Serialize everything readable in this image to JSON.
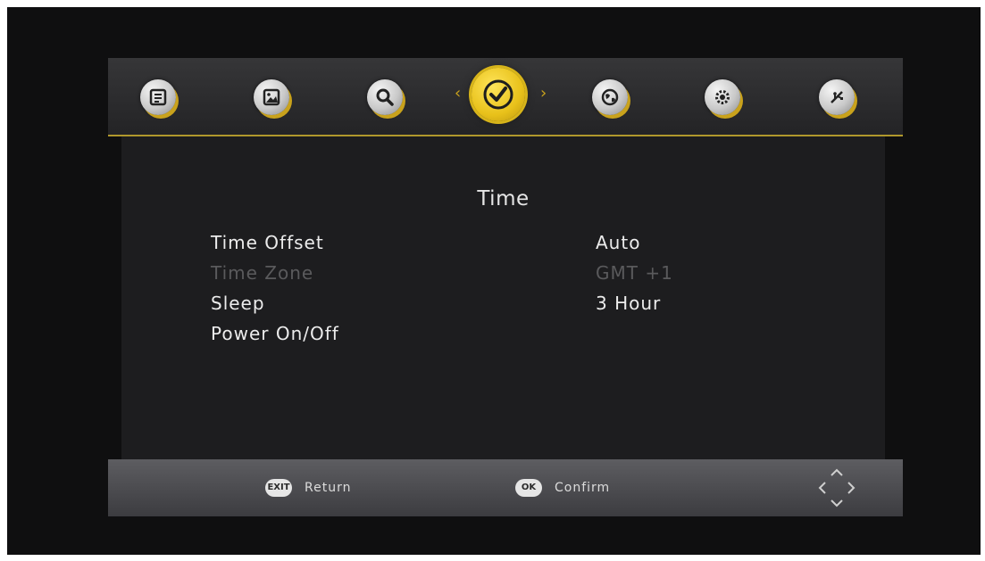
{
  "topbar": {
    "items": [
      {
        "icon": "channel-list-icon"
      },
      {
        "icon": "picture-icon"
      },
      {
        "icon": "search-icon"
      },
      {
        "icon": "clock-icon",
        "active": true
      },
      {
        "icon": "globe-icon"
      },
      {
        "icon": "gear-icon"
      },
      {
        "icon": "usb-icon"
      }
    ],
    "active_index": 3,
    "accent_color": "#e8c11a"
  },
  "menu": {
    "title": "Time",
    "items": [
      {
        "label": "Time Offset",
        "value": "Auto",
        "enabled": true
      },
      {
        "label": "Time Zone",
        "value": "GMT +1",
        "enabled": false
      },
      {
        "label": "Sleep",
        "value": "3 Hour",
        "enabled": true
      },
      {
        "label": "Power On/Off",
        "value": "",
        "enabled": true
      }
    ]
  },
  "footer": {
    "hints": [
      {
        "key": "EXIT",
        "label": "Return"
      },
      {
        "key": "OK",
        "label": "Confirm"
      }
    ],
    "nav_icon": "direction-pad-icon"
  }
}
